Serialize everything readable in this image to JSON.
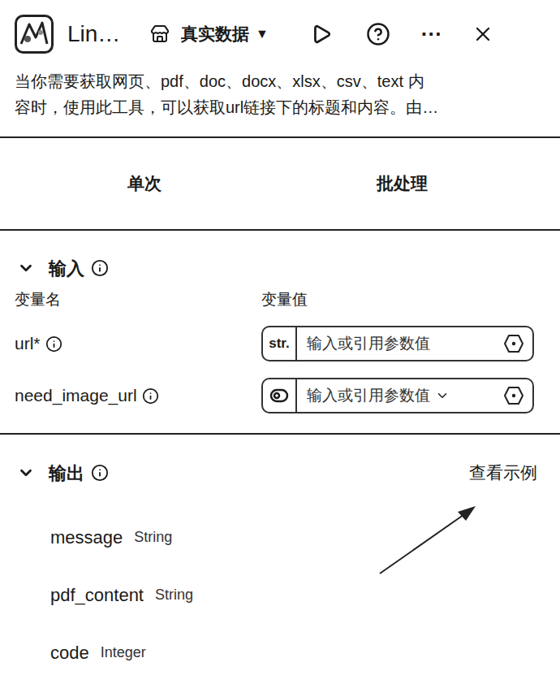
{
  "header": {
    "title": "Lin…",
    "mode": "真实数据",
    "mode_caret": "▼",
    "more": "···"
  },
  "description_lines": [
    "当你需要获取网页、pdf、doc、docx、xlsx、csv、text 内",
    "容时，使用此工具，可以获取url链接下的标题和内容。由…"
  ],
  "tabs": [
    {
      "label": "单次"
    },
    {
      "label": "批处理"
    }
  ],
  "input": {
    "title": "输入",
    "expanded": true,
    "columns": [
      "变量名",
      "变量值"
    ],
    "rows": [
      {
        "name": "url*",
        "kind": "text",
        "type_badge": "str.",
        "placeholder": "输入或引用参数值"
      },
      {
        "name": "need_image_url",
        "kind": "boolean",
        "placeholder": "输入或引用参数值"
      }
    ]
  },
  "output": {
    "title": "输出",
    "expanded": true,
    "example_link": "查看示例",
    "fields": [
      {
        "name": "message",
        "type": "String"
      },
      {
        "name": "pdf_content",
        "type": "String"
      },
      {
        "name": "code",
        "type": "Integer"
      }
    ]
  }
}
